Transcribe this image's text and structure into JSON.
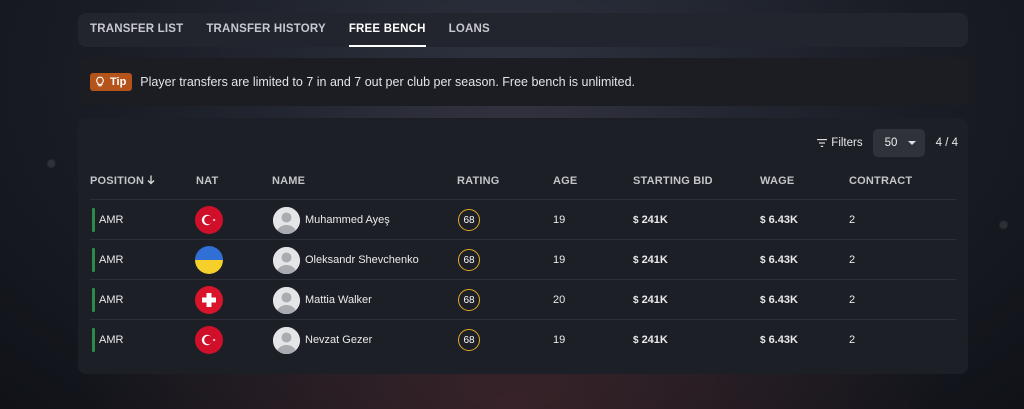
{
  "tabs": [
    {
      "label": "TRANSFER LIST",
      "active": false
    },
    {
      "label": "TRANSFER HISTORY",
      "active": false
    },
    {
      "label": "FREE BENCH",
      "active": true
    },
    {
      "label": "LOANS",
      "active": false
    }
  ],
  "tip": {
    "badge": "Tip",
    "icon": "lightbulb-icon",
    "text": "Player transfers are limited to 7 in and 7 out per club per season. Free bench is unlimited."
  },
  "toolbar": {
    "filters_label": "Filters",
    "page_size": "50",
    "count": "4 / 4"
  },
  "table": {
    "columns": [
      "POSITION",
      "NAT",
      "NAME",
      "RATING",
      "AGE",
      "STARTING BID",
      "WAGE",
      "CONTRACT"
    ],
    "sort_icon": "arrow-down-icon",
    "currency_icon": "currency-icon",
    "rows": [
      {
        "position": "AMR",
        "nationality": "turkey-flag",
        "name": "Muhammed Ayeş",
        "rating": "68",
        "age": "19",
        "bid": "241K",
        "wage": "6.43K",
        "contract": "2"
      },
      {
        "position": "AMR",
        "nationality": "ukraine-flag",
        "name": "Oleksandr Shevchenko",
        "rating": "68",
        "age": "19",
        "bid": "241K",
        "wage": "6.43K",
        "contract": "2"
      },
      {
        "position": "AMR",
        "nationality": "switzerland-flag",
        "name": "Mattia Walker",
        "rating": "68",
        "age": "20",
        "bid": "241K",
        "wage": "6.43K",
        "contract": "2"
      },
      {
        "position": "AMR",
        "nationality": "turkey-flag",
        "name": "Nevzat Gezer",
        "rating": "68",
        "age": "19",
        "bid": "241K",
        "wage": "6.43K",
        "contract": "2"
      }
    ]
  },
  "colors": {
    "position_bar": "#2d8a4b",
    "rating_ring": "#e5a92a",
    "tip_badge": "#b5541a"
  }
}
